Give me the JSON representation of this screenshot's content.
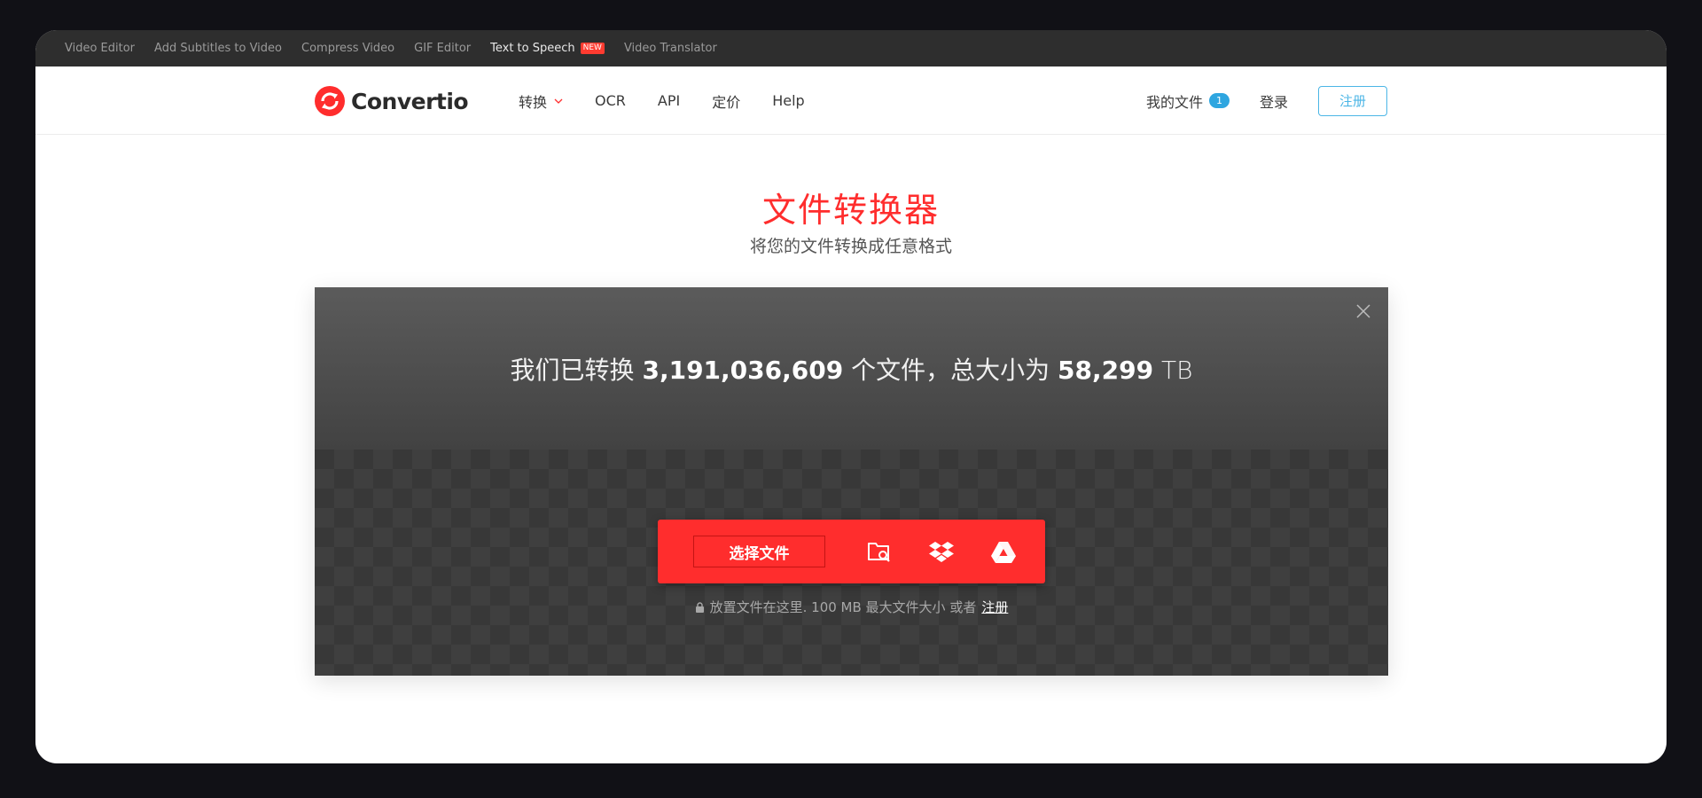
{
  "topbar": {
    "links": [
      "Video Editor",
      "Add Subtitles to Video",
      "Compress Video",
      "GIF Editor",
      "Text to Speech",
      "Video Translator"
    ],
    "new_badge": "NEW"
  },
  "nav": {
    "logo_text": "Convertio",
    "menu": [
      "转换",
      "OCR",
      "API",
      "定价",
      "Help"
    ],
    "my_files_label": "我的文件",
    "my_files_count": "1",
    "login_label": "登录",
    "signup_label": "注册"
  },
  "hero": {
    "title": "文件转换器",
    "subtitle": "将您的文件转换成任意格式"
  },
  "stats": {
    "prefix": "我们已转换",
    "files_count": "3,191,036,609",
    "middle": "个文件，总大小为",
    "total_size": "58,299",
    "unit": "TB"
  },
  "upload": {
    "choose_label": "选择文件",
    "icons": [
      "folder-search-icon",
      "dropbox-icon",
      "google-drive-icon"
    ],
    "hint_text": "放置文件在这里. 100 MB 最大文件大小 或者",
    "hint_link": "注册"
  },
  "colors": {
    "accent_red": "#ff2d2d",
    "accent_blue": "#2fa6e0",
    "topbar_bg": "#2e2e2e"
  }
}
